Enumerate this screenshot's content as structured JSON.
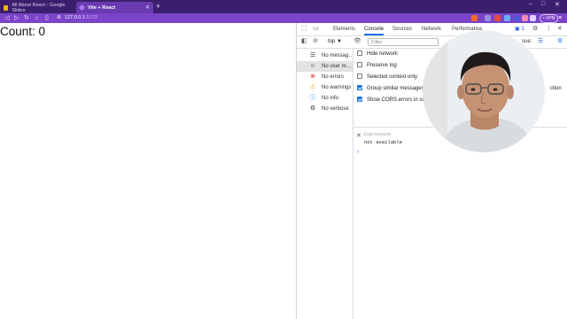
{
  "browser": {
    "tabs": [
      {
        "title": "All About React - Google Slides",
        "favicon_color": "#f4b400",
        "active": false
      },
      {
        "title": "Vite + React",
        "favicon_color": "#a77bf3",
        "active": true
      }
    ],
    "new_tab": "+",
    "window_controls": [
      "–",
      "□",
      "✕"
    ],
    "nav": {
      "back": "◁",
      "forward": "▷",
      "reload": "↻",
      "home": "⌂",
      "bookmark": "▯"
    },
    "url": {
      "host": "127.0.0.1",
      "port": ":5173"
    },
    "vpn_label": "• VPN",
    "menu": "≡"
  },
  "page": {
    "count_text": "Count: 0"
  },
  "devtools": {
    "tabs": [
      "Elements",
      "Console",
      "Sources",
      "Network",
      "Performance"
    ],
    "active_tab": "Console",
    "context": "top ▼",
    "filter_placeholder": "Filter",
    "issues": "1",
    "issue_label": "sue:",
    "sidebar": [
      {
        "icon": "☰",
        "label": "No messag…",
        "selected": false
      },
      {
        "icon": "☺",
        "label": "No user m…",
        "selected": true
      },
      {
        "icon": "⊗",
        "label": "No errors",
        "selected": false
      },
      {
        "icon": "⚠",
        "label": "No warnings",
        "selected": false
      },
      {
        "icon": "ⓘ",
        "label": "No info",
        "selected": false
      },
      {
        "icon": "⚙",
        "label": "No verbose",
        "selected": false
      }
    ],
    "settings": [
      {
        "label": "Hide network",
        "checked": false
      },
      {
        "label": "Preserve log",
        "checked": false
      },
      {
        "label": "Selected context only",
        "checked": false
      },
      {
        "label": "Group similar messages",
        "checked": true
      },
      {
        "label": "Show CORS errors in con",
        "checked": true
      }
    ],
    "right_setting_fragment": "ction",
    "expression_label": "Expression",
    "expression_value": "not available",
    "prompt": "›"
  },
  "colors": {
    "tabstrip": "#3b1f6e",
    "toolbar": "#7b44c9",
    "accent": "#1a73e8"
  }
}
